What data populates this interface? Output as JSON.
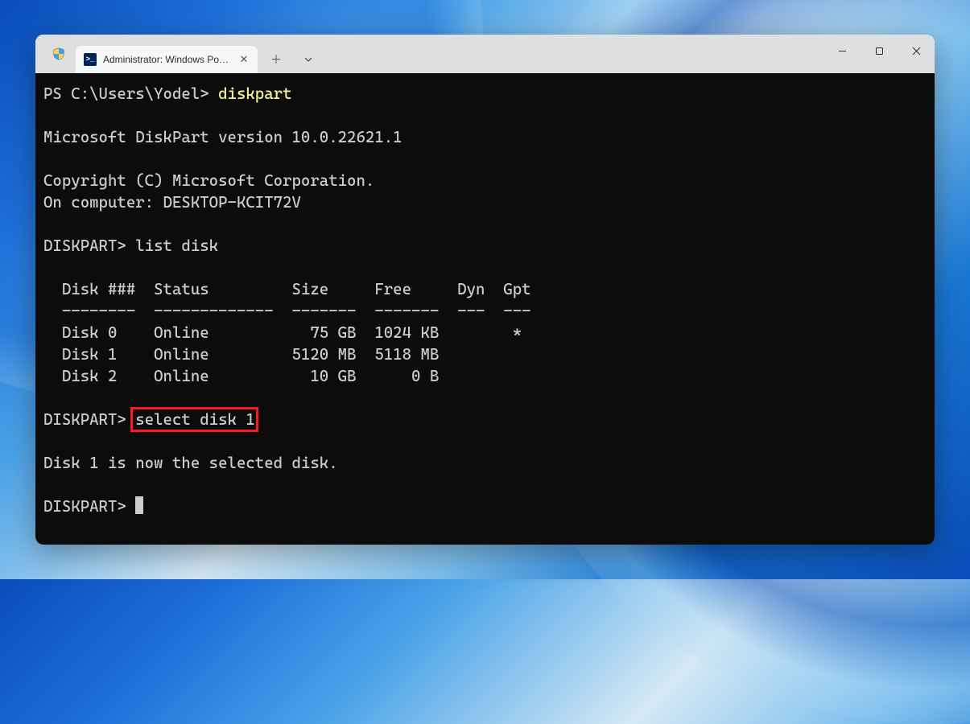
{
  "window": {
    "tab_title": "Administrator: Windows Powe",
    "controls": {
      "min": "—",
      "max": "□",
      "close": "✕"
    }
  },
  "terminal": {
    "line1_prompt": "PS C:\\Users\\Yodel> ",
    "line1_cmd": "diskpart",
    "blank1": "",
    "line2": "Microsoft DiskPart version 10.0.22621.1",
    "blank2": "",
    "line3": "Copyright (C) Microsoft Corporation.",
    "line4": "On computer: DESKTOP-KCIT72V",
    "blank3": "",
    "line5": "DISKPART> list disk",
    "blank4": "",
    "header": "  Disk ###  Status         Size     Free     Dyn  Gpt",
    "divider": "  --------  -------------  -------  -------  ---  ---",
    "row0": "  Disk 0    Online           75 GB  1024 KB        *",
    "row1": "  Disk 1    Online         5120 MB  5118 MB",
    "row2": "  Disk 2    Online           10 GB      0 B",
    "blank5": "",
    "line6_prompt": "DISKPART> ",
    "line6_cmd": "select disk 1",
    "blank6": "",
    "line7": "Disk 1 is now the selected disk.",
    "blank7": "",
    "line8": "DISKPART> "
  }
}
